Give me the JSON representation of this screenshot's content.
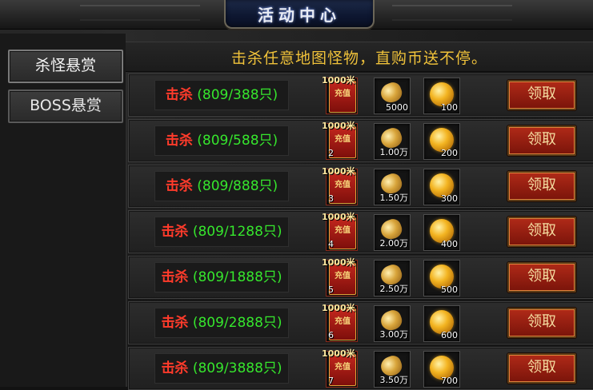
{
  "title": "活动中心",
  "sidebar": {
    "items": [
      {
        "label": "杀怪悬赏"
      },
      {
        "label": "BOSS悬赏"
      }
    ]
  },
  "header": {
    "text": "击杀任意地图怪物，直购币送不停。"
  },
  "rows": [
    {
      "kill_word": "击杀",
      "count": "(809/388只)",
      "recharge_label": "1000米",
      "recharge_qty": "",
      "ingot_qty": "5000",
      "coin_qty": "100",
      "button": "领取"
    },
    {
      "kill_word": "击杀",
      "count": "(809/588只)",
      "recharge_label": "1000米",
      "recharge_qty": "2",
      "ingot_qty": "1.00万",
      "coin_qty": "200",
      "button": "领取"
    },
    {
      "kill_word": "击杀",
      "count": "(809/888只)",
      "recharge_label": "1000米",
      "recharge_qty": "3",
      "ingot_qty": "1.50万",
      "coin_qty": "300",
      "button": "领取"
    },
    {
      "kill_word": "击杀",
      "count": "(809/1288只)",
      "recharge_label": "1000米",
      "recharge_qty": "4",
      "ingot_qty": "2.00万",
      "coin_qty": "400",
      "button": "领取"
    },
    {
      "kill_word": "击杀",
      "count": "(809/1888只)",
      "recharge_label": "1000米",
      "recharge_qty": "5",
      "ingot_qty": "2.50万",
      "coin_qty": "500",
      "button": "领取"
    },
    {
      "kill_word": "击杀",
      "count": "(809/2888只)",
      "recharge_label": "1000米",
      "recharge_qty": "6",
      "ingot_qty": "3.00万",
      "coin_qty": "600",
      "button": "领取"
    },
    {
      "kill_word": "击杀",
      "count": "(809/3888只)",
      "recharge_label": "1000米",
      "recharge_qty": "7",
      "ingot_qty": "3.50万",
      "coin_qty": "700",
      "button": "领取"
    }
  ],
  "card_glyph": "充值",
  "icons": {
    "recharge": "recharge-card-icon",
    "ingot": "gold-ingot-icon",
    "coin": "gold-coin-icon"
  },
  "colors": {
    "kill_word": "#ff3b2b",
    "kill_count": "#36e62d",
    "header_text": "#f0c23a",
    "button": "#b02a18"
  }
}
